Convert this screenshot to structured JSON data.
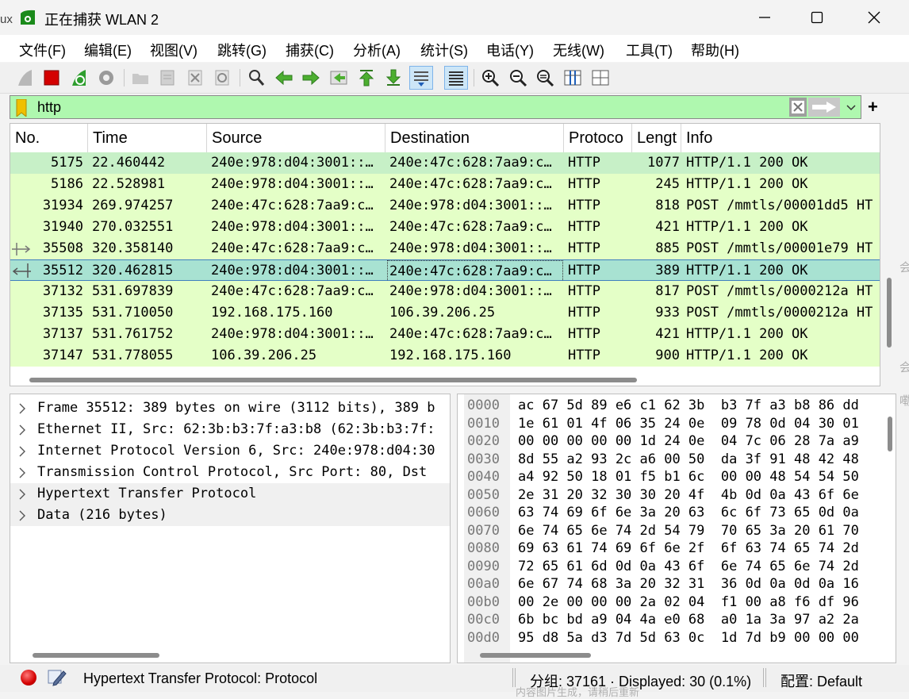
{
  "window": {
    "title": "正在捕获 WLAN 2"
  },
  "menu": [
    "文件(F)",
    "编辑(E)",
    "视图(V)",
    "跳转(G)",
    "捕获(C)",
    "分析(A)",
    "统计(S)",
    "电话(Y)",
    "无线(W)",
    "工具(T)",
    "帮助(H)"
  ],
  "toolbar": {
    "icons": [
      "shark-fin-start-icon",
      "stop-capture-icon",
      "restart-capture-icon",
      "capture-options-icon",
      "open-file-icon",
      "save-file-icon",
      "close-file-icon",
      "reload-file-icon",
      "find-packet-icon",
      "go-back-icon",
      "go-forward-icon",
      "go-to-packet-icon",
      "go-first-icon",
      "go-last-icon",
      "autoscroll-icon",
      "colorize-icon",
      "zoom-in-icon",
      "zoom-out-icon",
      "zoom-normal-icon",
      "resize-columns-icon",
      "expand-subtrees-icon"
    ]
  },
  "filter": {
    "value": "http",
    "clear_icon": "clear-filter-icon",
    "apply_icon": "apply-filter-arrow-icon",
    "add_label": "+"
  },
  "packet_list": {
    "columns": [
      "No.",
      "Time",
      "Source",
      "Destination",
      "Protoco",
      "Lengt",
      "Info"
    ],
    "rows": [
      {
        "no": "5175",
        "time": "22.460442",
        "src": "240e:978:d04:3001::…",
        "dst": "240e:47c:628:7aa9:c…",
        "proto": "HTTP",
        "len": "1077",
        "info": "HTTP/1.1 200 OK"
      },
      {
        "no": "5186",
        "time": "22.528981",
        "src": "240e:978:d04:3001::…",
        "dst": "240e:47c:628:7aa9:c…",
        "proto": "HTTP",
        "len": "245",
        "info": "HTTP/1.1 200 OK"
      },
      {
        "no": "31934",
        "time": "269.974257",
        "src": "240e:47c:628:7aa9:c…",
        "dst": "240e:978:d04:3001::…",
        "proto": "HTTP",
        "len": "818",
        "info": "POST /mmtls/00001dd5 HT"
      },
      {
        "no": "31940",
        "time": "270.032551",
        "src": "240e:978:d04:3001::…",
        "dst": "240e:47c:628:7aa9:c…",
        "proto": "HTTP",
        "len": "421",
        "info": "HTTP/1.1 200 OK"
      },
      {
        "no": "35508",
        "time": "320.358140",
        "src": "240e:47c:628:7aa9:c…",
        "dst": "240e:978:d04:3001::…",
        "proto": "HTTP",
        "len": "885",
        "info": "POST /mmtls/00001e79 HT"
      },
      {
        "no": "35512",
        "time": "320.462815",
        "src": "240e:978:d04:3001::…",
        "dst": "240e:47c:628:7aa9:c…",
        "proto": "HTTP",
        "len": "389",
        "info": "HTTP/1.1 200 OK"
      },
      {
        "no": "37132",
        "time": "531.697839",
        "src": "240e:47c:628:7aa9:c…",
        "dst": "240e:978:d04:3001::…",
        "proto": "HTTP",
        "len": "817",
        "info": "POST /mmtls/0000212a HT"
      },
      {
        "no": "37135",
        "time": "531.710050",
        "src": "192.168.175.160",
        "dst": "106.39.206.25",
        "proto": "HTTP",
        "len": "933",
        "info": "POST /mmtls/0000212a HT"
      },
      {
        "no": "37137",
        "time": "531.761752",
        "src": "240e:978:d04:3001::…",
        "dst": "240e:47c:628:7aa9:c…",
        "proto": "HTTP",
        "len": "421",
        "info": "HTTP/1.1 200 OK"
      },
      {
        "no": "37147",
        "time": "531.778055",
        "src": "106.39.206.25",
        "dst": "192.168.175.160",
        "proto": "HTTP",
        "len": "900",
        "info": "HTTP/1.1 200 OK"
      }
    ]
  },
  "details": [
    "Frame 35512: 389 bytes on wire (3112 bits), 389 b",
    "Ethernet II, Src: 62:3b:b3:7f:a3:b8 (62:3b:b3:7f:",
    "Internet Protocol Version 6, Src: 240e:978:d04:30",
    "Transmission Control Protocol, Src Port: 80, Dst",
    "Hypertext Transfer Protocol",
    "Data (216 bytes)"
  ],
  "bytes": [
    {
      "off": "0000",
      "hex": "ac 67 5d 89 e6 c1 62 3b  b3 7f a3 b8 86 dd"
    },
    {
      "off": "0010",
      "hex": "1e 61 01 4f 06 35 24 0e  09 78 0d 04 30 01"
    },
    {
      "off": "0020",
      "hex": "00 00 00 00 00 1d 24 0e  04 7c 06 28 7a a9"
    },
    {
      "off": "0030",
      "hex": "8d 55 a2 93 2c a6 00 50  da 3f 91 48 42 48"
    },
    {
      "off": "0040",
      "hex": "a4 92 50 18 01 f5 b1 6c  00 00 48 54 54 50"
    },
    {
      "off": "0050",
      "hex": "2e 31 20 32 30 30 20 4f  4b 0d 0a 43 6f 6e"
    },
    {
      "off": "0060",
      "hex": "63 74 69 6f 6e 3a 20 63  6c 6f 73 65 0d 0a"
    },
    {
      "off": "0070",
      "hex": "6e 74 65 6e 74 2d 54 79  70 65 3a 20 61 70"
    },
    {
      "off": "0080",
      "hex": "69 63 61 74 69 6f 6e 2f  6f 63 74 65 74 2d"
    },
    {
      "off": "0090",
      "hex": "72 65 61 6d 0d 0a 43 6f  6e 74 65 6e 74 2d"
    },
    {
      "off": "00a0",
      "hex": "6e 67 74 68 3a 20 32 31  36 0d 0a 0d 0a 16"
    },
    {
      "off": "00b0",
      "hex": "00 2e 00 00 00 2a 02 04  f1 00 a8 f6 df 96"
    },
    {
      "off": "00c0",
      "hex": "6b bc bd a9 04 4a e0 68  a0 1a 3a 97 a2 2a"
    },
    {
      "off": "00d0",
      "hex": "95 d8 5a d3 7d 5d 63 0c  1d 7d b9 00 00 00"
    }
  ],
  "status": {
    "field": "Hypertext Transfer Protocol: Protocol",
    "packets": "分组: 37161 · Displayed: 30 (0.1%)",
    "profile": "配置:  Default"
  },
  "background_artifacts": [
    "ux",
    "会",
    "会",
    "嘞",
    "内容图片生成，请稍后重新"
  ]
}
